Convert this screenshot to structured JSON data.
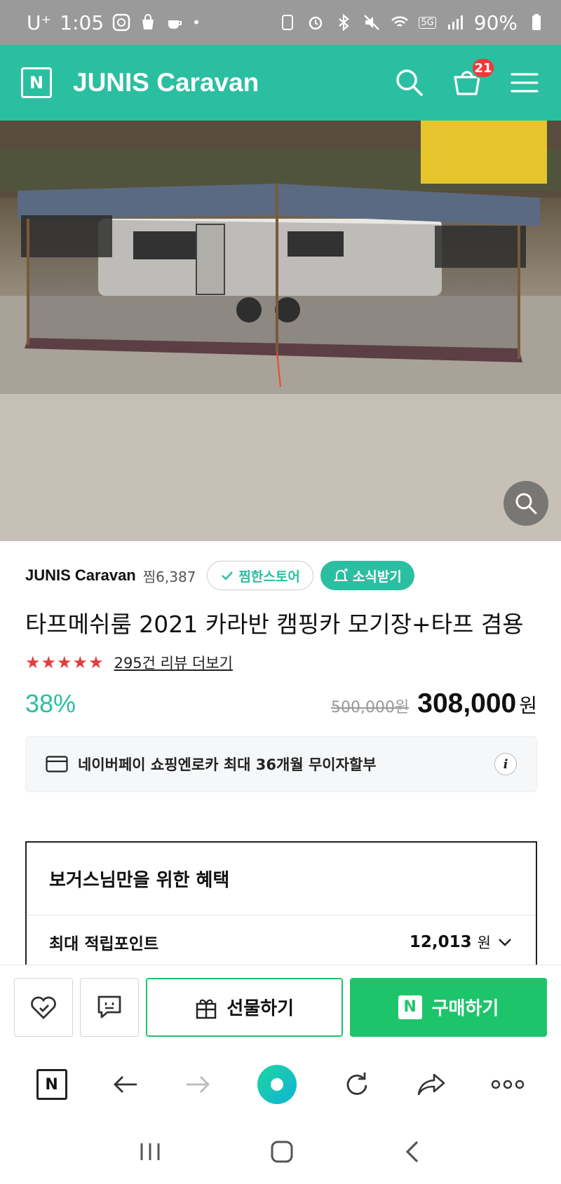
{
  "status_bar": {
    "carrier": "U⁺",
    "time": "1:05",
    "network": "5G",
    "battery": "90%"
  },
  "header": {
    "logo_letter": "N",
    "store_title": "JUNIS Caravan",
    "cart_count": "21",
    "accent_color": "#2bbfa1"
  },
  "hero": {
    "description_icon": "zoom-icon"
  },
  "product": {
    "seller_name": "JUNIS Caravan",
    "zzim_count": "찜6,387",
    "follow_store_label": "찜한스토어",
    "news_label": "소식받기",
    "title": "타프메쉬룸 2021 카라반 캠핑카 모기장+타프 겸용",
    "stars": "★★★★★",
    "rating_fraction": 0.9,
    "review_link": "295건 리뷰 더보기",
    "discount": "38%",
    "original_price": "500,000원",
    "price": "308,000",
    "price_unit": "원",
    "pay_notice": "네이버페이 쇼핑엔로카 최대 36개월 무이자할부"
  },
  "benefit": {
    "title": "보거스님만을 위한 혜택",
    "max_points_label": "최대 적립포인트",
    "max_points_value": "12,013",
    "max_points_unit": "원"
  },
  "actions": {
    "gift_label": "선물하기",
    "buy_label": "구매하기",
    "buy_logo": "N",
    "buy_color": "#1ec46a"
  },
  "browser": {
    "home_letter": "N"
  }
}
